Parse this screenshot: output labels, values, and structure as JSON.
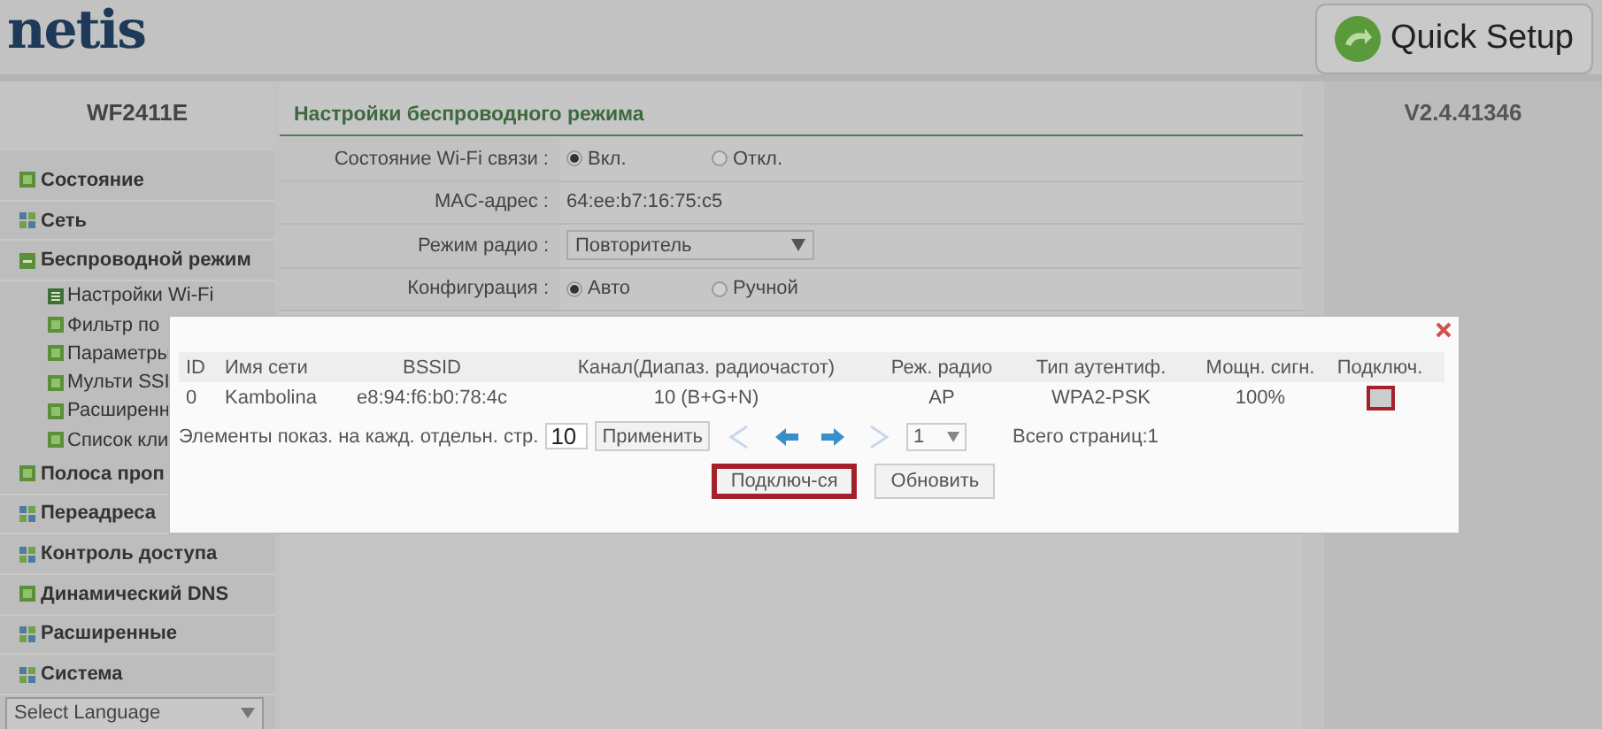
{
  "header": {
    "logo": "netis",
    "quick_setup": "Quick Setup"
  },
  "sidebar": {
    "model": "WF2411E",
    "items": [
      {
        "label": "Состояние",
        "kind": "square"
      },
      {
        "label": "Сеть",
        "kind": "grid"
      },
      {
        "label": "Беспроводной режим",
        "kind": "open",
        "children": [
          {
            "label": "Настройки Wi-Fi",
            "kind": "page"
          },
          {
            "label": "Фильтр по",
            "kind": "square"
          },
          {
            "label": "Параметры",
            "kind": "square"
          },
          {
            "label": "Мульти SSI",
            "kind": "square"
          },
          {
            "label": "Расширенн",
            "kind": "square"
          },
          {
            "label": "Список кли",
            "kind": "square"
          }
        ]
      },
      {
        "label": "Полоса проп",
        "kind": "square"
      },
      {
        "label": "Переадреса",
        "kind": "grid"
      },
      {
        "label": "Контроль доступа",
        "kind": "grid"
      },
      {
        "label": "Динамический DNS",
        "kind": "square"
      },
      {
        "label": "Расширенные",
        "kind": "grid"
      },
      {
        "label": "Система",
        "kind": "grid"
      }
    ],
    "language": "Select Language"
  },
  "main": {
    "title": "Настройки беспроводного режима",
    "rows": [
      {
        "kind": "radio",
        "label": "Состояние Wi-Fi связи :",
        "options": [
          {
            "label": "Вкл.",
            "selected": true
          },
          {
            "label": "Откл.",
            "selected": false
          }
        ]
      },
      {
        "kind": "text",
        "label": "MAC-адрес :",
        "value": "64:ee:b7:16:75:c5"
      },
      {
        "kind": "select",
        "label": "Режим радио :",
        "value": "Повторитель"
      },
      {
        "kind": "radio",
        "label": "Конфигурация :",
        "options": [
          {
            "label": "Авто",
            "selected": true
          },
          {
            "label": "Ручной",
            "selected": false
          }
        ]
      }
    ]
  },
  "version": "V2.4.41346",
  "modal": {
    "columns": [
      "ID",
      "Имя сети",
      "BSSID",
      "Канал(Диапаз. радиочастот)",
      "Реж. радио",
      "Тип аутентиф.",
      "Мощн. сигн.",
      "Подключ."
    ],
    "rows": [
      {
        "cells": [
          "0",
          "Kambolina",
          "e8:94:f6:b0:78:4c",
          "10 (B+G+N)",
          "AP",
          "WPA2-PSK",
          "100%"
        ],
        "connect_highlighted": true
      }
    ],
    "pager": {
      "label": "Элементы показ. на кажд. отдельн. стр.",
      "per_page": "10",
      "apply": "Применить",
      "page": "1",
      "total": "Всего страниц:1"
    },
    "buttons": [
      {
        "label": "Подключ-ся",
        "highlighted": true
      },
      {
        "label": "Обновить",
        "highlighted": false
      }
    ]
  }
}
